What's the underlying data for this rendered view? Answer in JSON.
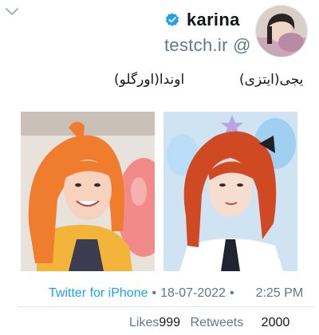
{
  "tweet": {
    "author": {
      "name": "karina",
      "handle": "testch.ir @",
      "verified": true,
      "avatar_icon": "profile-photo"
    },
    "captions": {
      "left": "اوندا(اورگلو)",
      "right": "یجی(ایتزی)"
    },
    "images": [
      {
        "icon": "photo-orange-hair-balloon"
      },
      {
        "icon": "photo-red-hair-uniform"
      }
    ],
    "meta": {
      "source": "Twitter for iPhone",
      "date": "18-07-2022",
      "separator": "•",
      "time": "2:25 PM"
    },
    "stats": {
      "likes_label": "Likes",
      "likes_count": "999",
      "retweets_label": "Retweets",
      "retweets_count": "2000"
    },
    "colors": {
      "accent": "#1da1f2",
      "muted": "#657786",
      "text": "#14171a"
    }
  },
  "header": {
    "menu_icon": "chevron-down-icon"
  }
}
